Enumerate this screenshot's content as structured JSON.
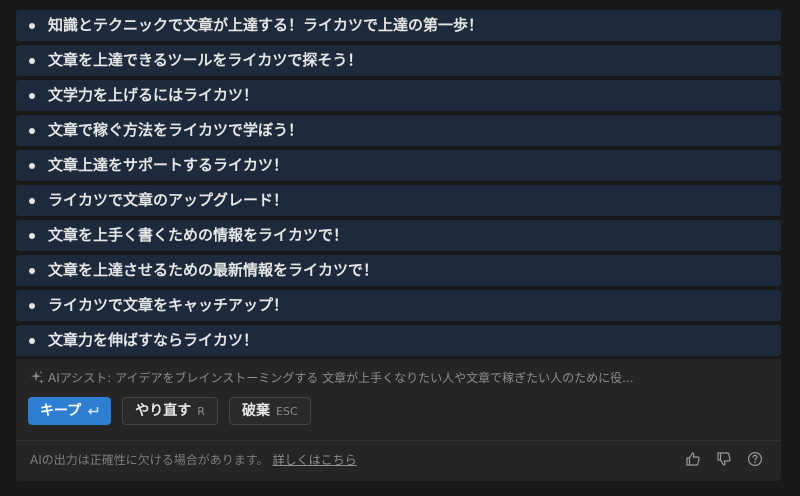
{
  "suggestions": [
    "知識とテクニックで文章が上達する！ライカツで上達の第一歩！",
    "文章を上達できるツールをライカツで探そう！",
    "文学力を上げるにはライカツ！",
    "文章で稼ぐ方法をライカツで学ぼう！",
    "文章上達をサポートするライカツ！",
    "ライカツで文章のアップグレード！",
    "文章を上手く書くための情報をライカツで！",
    "文章を上達させるための最新情報をライカツで！",
    "ライカツで文章をキャッチアップ！",
    "文章力を伸ばすならライカツ！"
  ],
  "assist": {
    "label": "AIアシスト: アイデアをブレインストーミングする 文章が上手くなりたい人や文章で稼ぎたい人のために役..."
  },
  "buttons": {
    "keep_label": "キープ",
    "retry_label": "やり直す",
    "retry_key": "R",
    "discard_label": "破棄",
    "discard_key": "ESC"
  },
  "footer": {
    "disclaimer": "AIの出力は正確性に欠ける場合があります。",
    "link": "詳しくはこちら"
  },
  "icons": {
    "sparkle": "sparkle-icon",
    "enter": "enter-icon",
    "thumbs_up": "thumbs-up-icon",
    "thumbs_down": "thumbs-down-icon",
    "help": "help-icon"
  },
  "colors": {
    "item_bg": "#1c2a3b",
    "primary": "#2e7fd4",
    "panel_bg": "#252525"
  }
}
